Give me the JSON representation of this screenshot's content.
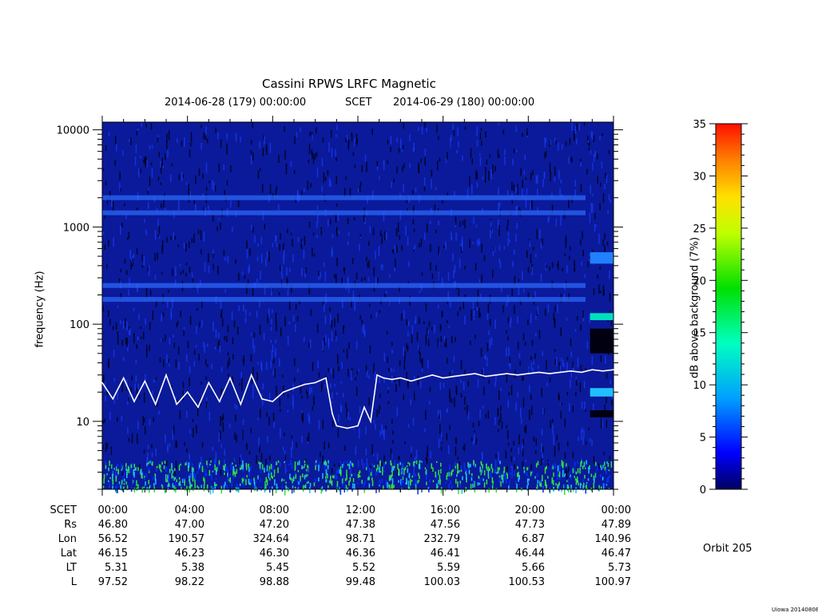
{
  "title": "Cassini RPWS LRFC Magnetic",
  "subtitle": {
    "start": "2014-06-28 (179) 00:00:00",
    "label": "SCET",
    "end": "2014-06-29 (180) 00:00:00"
  },
  "ylabel": "frequency (Hz)",
  "colorbar": {
    "label": "dB above background (7%)",
    "ticks": [
      "0",
      "5",
      "10",
      "15",
      "20",
      "25",
      "30",
      "35"
    ],
    "range": [
      0,
      35
    ]
  },
  "orbit": "Orbit 205",
  "footer": "Uiowa 20140808",
  "ephemeris": {
    "rows": [
      {
        "name": "SCET",
        "values": [
          "00:00",
          "04:00",
          "08:00",
          "12:00",
          "16:00",
          "20:00",
          "00:00"
        ]
      },
      {
        "name": "Rs",
        "values": [
          "46.80",
          "47.00",
          "47.20",
          "47.38",
          "47.56",
          "47.73",
          "47.89"
        ]
      },
      {
        "name": "Lon",
        "values": [
          "56.52",
          "190.57",
          "324.64",
          "98.71",
          "232.79",
          "6.87",
          "140.96"
        ]
      },
      {
        "name": "Lat",
        "values": [
          "46.15",
          "46.23",
          "46.30",
          "46.36",
          "46.41",
          "46.44",
          "46.47"
        ]
      },
      {
        "name": "LT",
        "values": [
          "5.31",
          "5.38",
          "5.45",
          "5.52",
          "5.59",
          "5.66",
          "5.73"
        ]
      },
      {
        "name": "L",
        "values": [
          "97.52",
          "98.22",
          "98.88",
          "99.48",
          "100.03",
          "100.53",
          "100.97"
        ]
      }
    ]
  },
  "chart_data": {
    "type": "heatmap",
    "title": "Cassini RPWS LRFC Magnetic",
    "xlabel": "SCET",
    "ylabel": "frequency (Hz)",
    "x_ticks": [
      "00:00",
      "04:00",
      "08:00",
      "12:00",
      "16:00",
      "20:00",
      "00:00"
    ],
    "y_ticks": [
      10,
      100,
      1000,
      10000
    ],
    "y_scale": "log",
    "ylim": [
      2,
      12000
    ],
    "xlim_hours": [
      0,
      24
    ],
    "colorscale_range_db": [
      0,
      35
    ],
    "line_series": {
      "name": "",
      "color": "#ffffff",
      "x_hours": [
        0,
        0.5,
        1,
        1.5,
        2,
        2.5,
        3,
        3.5,
        4,
        4.5,
        5,
        5.5,
        6,
        6.5,
        7,
        7.5,
        8,
        8.5,
        9,
        9.5,
        10,
        10.5,
        10.8,
        11,
        11.5,
        12,
        12.3,
        12.6,
        12.9,
        13.2,
        13.6,
        14,
        14.5,
        15,
        15.5,
        16,
        16.5,
        17,
        17.5,
        18,
        18.5,
        19,
        19.5,
        20,
        20.5,
        21,
        21.5,
        22,
        22.5,
        23,
        23.5,
        24
      ],
      "y_hz": [
        25,
        17,
        28,
        16,
        26,
        15,
        30,
        15,
        20,
        14,
        25,
        16,
        28,
        15,
        30,
        17,
        16,
        20,
        22,
        24,
        25,
        28,
        12,
        9,
        8.5,
        9,
        14,
        10,
        30,
        28,
        27,
        28,
        26,
        28,
        30,
        28,
        29,
        30,
        31,
        29,
        30,
        31,
        30,
        31,
        32,
        31,
        32,
        33,
        32,
        34,
        33,
        34
      ]
    },
    "bands_hz": [
      180,
      250,
      2000,
      1400
    ],
    "grid": false
  }
}
